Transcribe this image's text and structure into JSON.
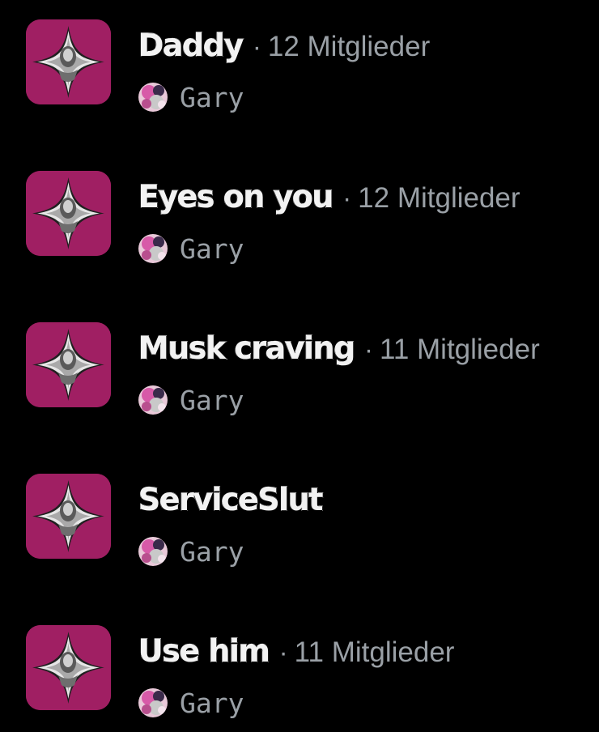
{
  "accent_colors": {
    "thumbnail_background": "#a01f63",
    "background": "#000000",
    "primary_text": "#f2f2f2",
    "secondary_text": "#9aa0a6"
  },
  "lists": [
    {
      "name": "Daddy",
      "separator": "·",
      "members": "12 Mitglieder",
      "owner": "Gary",
      "icon": "list-thumbnail-icon",
      "avatar_icon": "owner-avatar-icon"
    },
    {
      "name": "Eyes on you",
      "separator": "·",
      "members": "12 Mitglieder",
      "owner": "Gary",
      "icon": "list-thumbnail-icon",
      "avatar_icon": "owner-avatar-icon"
    },
    {
      "name": "Musk craving",
      "separator": "·",
      "members": "11 Mitglieder",
      "owner": "Gary",
      "icon": "list-thumbnail-icon",
      "avatar_icon": "owner-avatar-icon"
    },
    {
      "name": "ServiceSlut",
      "separator": "",
      "members": "",
      "owner": "Gary",
      "icon": "list-thumbnail-icon",
      "avatar_icon": "owner-avatar-icon"
    },
    {
      "name": "Use him",
      "separator": "·",
      "members": "11 Mitglieder",
      "owner": "Gary",
      "icon": "list-thumbnail-icon",
      "avatar_icon": "owner-avatar-icon"
    }
  ]
}
